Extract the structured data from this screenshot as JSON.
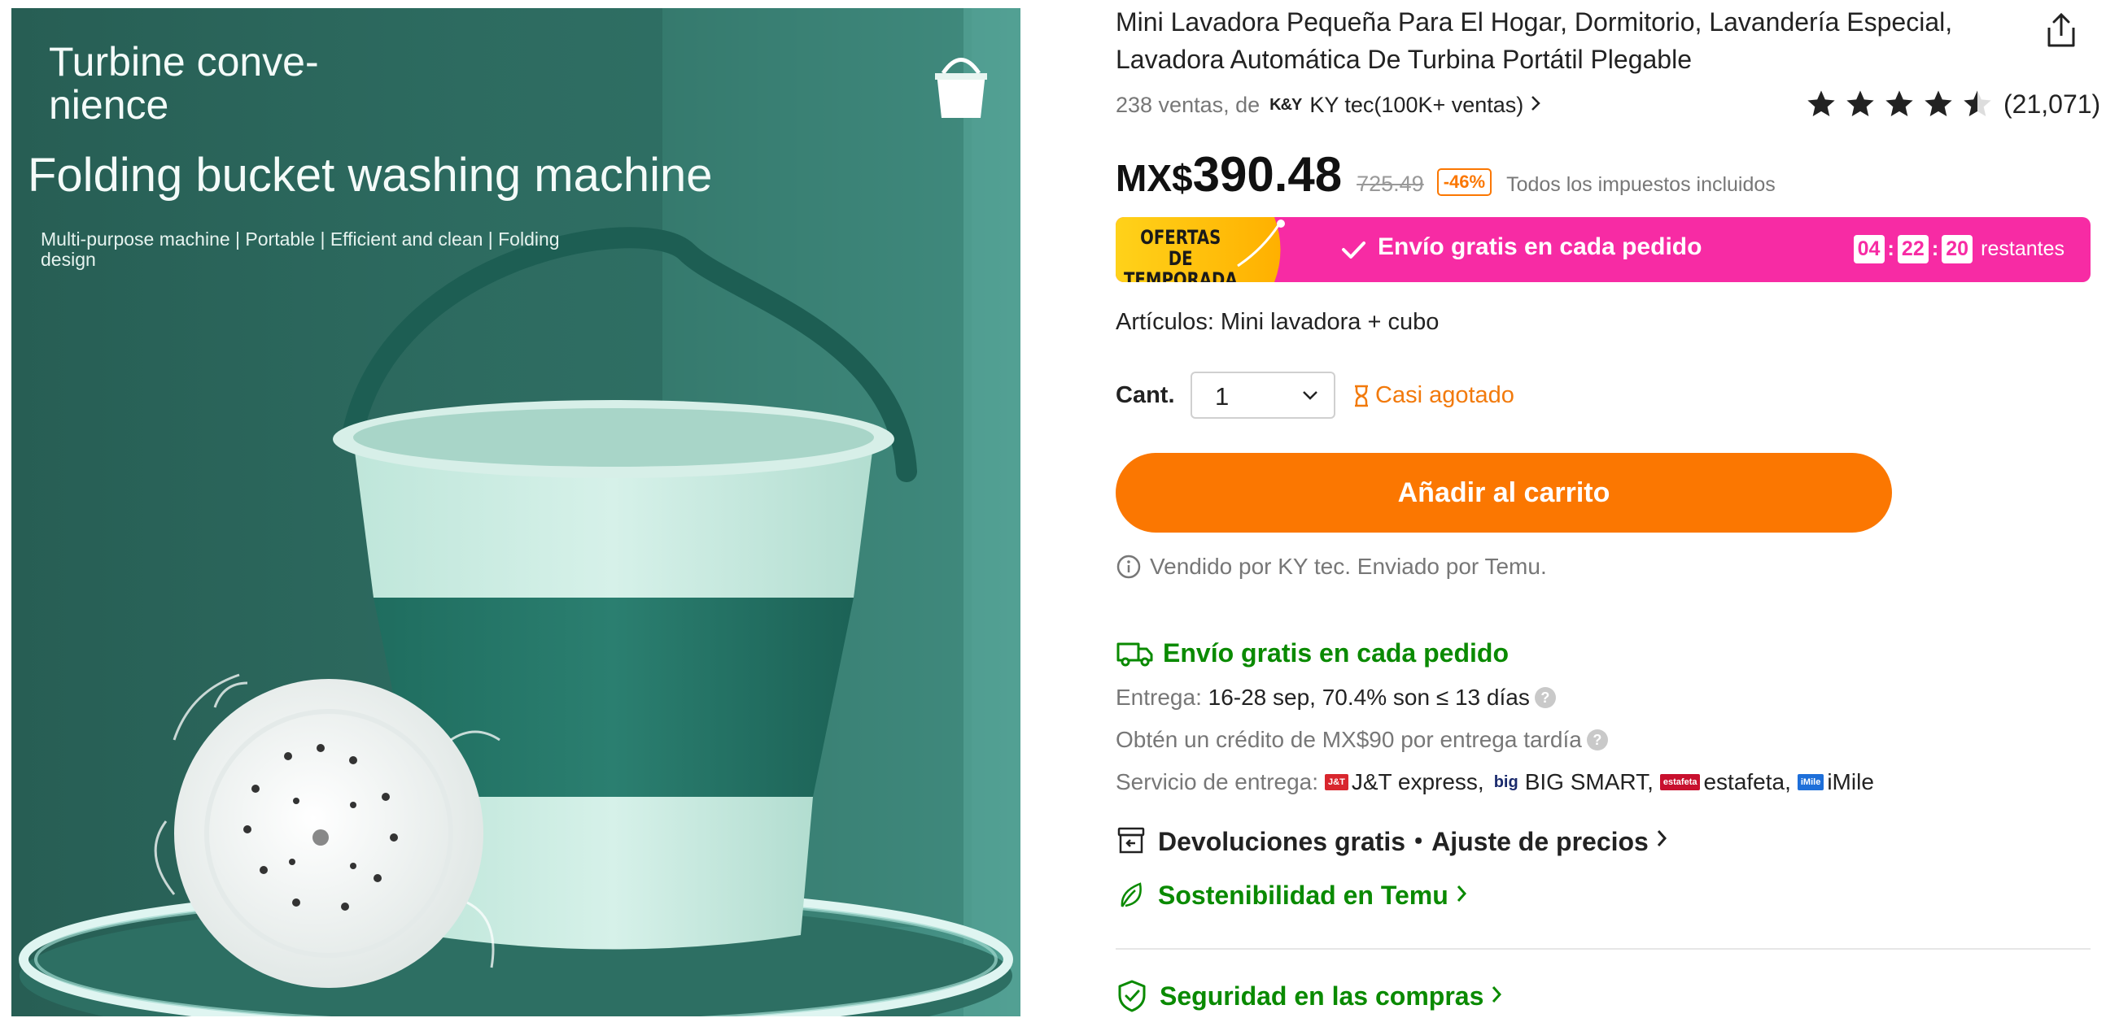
{
  "product_image": {
    "headline_1": "Turbine conve-\nnience",
    "headline_2": "Folding bucket washing machine",
    "tagline": "Multi-purpose machine | Portable | Efficient and clean | Folding design"
  },
  "product": {
    "title": "Mini Lavadora Pequeña Para El Hogar, Dormitorio, Lavandería Especial, Lavadora Automática De Turbina Portátil Plegable",
    "sales_prefix": "238 ventas, de",
    "seller_logo": "K&Y",
    "seller_name": "KY tec(100K+ ventas)",
    "rating_value": 4.5,
    "rating_count": "(21,071)"
  },
  "price": {
    "currency": "MX$",
    "amount": "390.48",
    "original": "725.49",
    "discount": "-46%",
    "tax_note": "Todos los impuestos incluidos"
  },
  "promo": {
    "badge": "OFERTAS\nDE TEMPORADA",
    "text": "Envío gratis en cada pedido",
    "timer_h": "04",
    "timer_m": "22",
    "timer_s": "20",
    "timer_sep": ":",
    "timer_suffix": "restantes"
  },
  "options": {
    "articles": "Artículos: Mini lavadora + cubo",
    "qty_label": "Cant.",
    "qty_value": "1",
    "stock_status": "Casi agotado",
    "add_to_cart": "Añadir al carrito",
    "sold_by": "Vendido por KY tec. Enviado por Temu."
  },
  "shipping": {
    "heading": "Envío gratis en cada pedido",
    "delivery_label": "Entrega:",
    "delivery_value": "16-28 sep, 70.4% son ≤ 13 días",
    "credit": "Obtén un crédito de MX$90 por entrega tardía",
    "service_label": "Servicio de entrega:",
    "carriers": [
      "J&T express,",
      "BIG SMART,",
      "estafeta,",
      "iMile"
    ],
    "carrier_logos": [
      "J&T",
      "big",
      "estafeta",
      "iMile"
    ]
  },
  "links": {
    "returns": "Devoluciones gratis・Ajuste de precios",
    "sustainability": "Sostenibilidad en Temu",
    "safety": "Seguridad en las compras"
  },
  "colors": {
    "accent_orange": "#fb7701",
    "promo_pink": "#f72ba4",
    "green": "#0a8a00"
  }
}
